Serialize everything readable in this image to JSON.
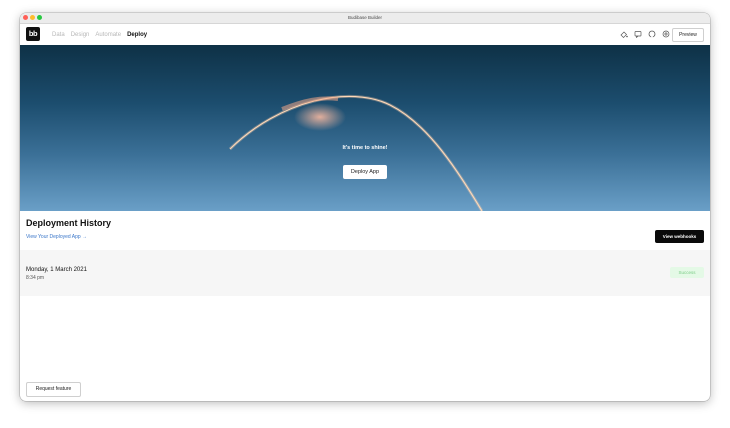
{
  "window": {
    "title": "Budibase Builder"
  },
  "nav": {
    "items": [
      {
        "label": "Data"
      },
      {
        "label": "Design"
      },
      {
        "label": "Automate"
      },
      {
        "label": "Deploy"
      }
    ],
    "active": "Deploy"
  },
  "toolbar": {
    "icons": [
      "theme-icon",
      "feedback-icon",
      "github-icon",
      "help-icon"
    ],
    "preview_label": "Preview"
  },
  "hero": {
    "title": "It's time to shine!",
    "deploy_label": "Deploy App"
  },
  "history": {
    "title": "Deployment History",
    "view_link": "View Your Deployed App →",
    "webhooks_label": "View webhooks",
    "rows": [
      {
        "date": "Monday, 1 March 2021",
        "time": "8:34 pm",
        "status": "Success"
      }
    ]
  },
  "footer": {
    "request_label": "Request feature"
  },
  "colors": {
    "accent_link": "#3a76c9",
    "success_bg": "#e4f9e6",
    "success_text": "#7acc86",
    "hero_top": "#0e3146",
    "hero_bottom": "#6a9fc7"
  }
}
